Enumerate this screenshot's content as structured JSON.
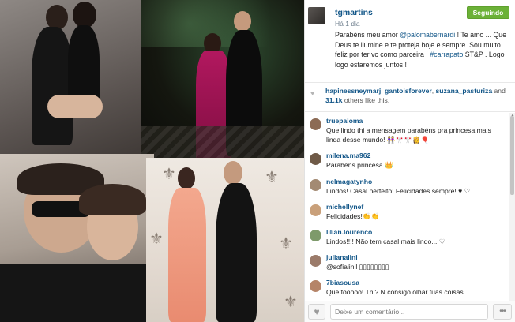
{
  "post": {
    "username": "tgmartins",
    "time": "Há 1 dia",
    "follow_label": "Seguindo",
    "caption_parts": {
      "a": "Parabéns meu amor ",
      "mention": "@palomabernardi",
      "b": " ! Te amo ... Que Deus te ilumine e te proteja hoje e sempre. Sou muito feliz por ter vc como parceira ! ",
      "hashtag": "#carrapato",
      "c": " ST&P . Logo logo estaremos juntos !"
    }
  },
  "likes": {
    "user1": "hapinessneymarj",
    "sep1": ", ",
    "user2": "gantoisforever",
    "sep2": ", ",
    "user3": "suzana_pasturiza",
    "and": " and",
    "count": "31.1k",
    "rest": " others like this."
  },
  "comments": [
    {
      "user": "truepaloma",
      "text": "Que lindo thi a mensagem parabéns pra princesa mais linda desse mundo! 👭🎌🎌👸🎈"
    },
    {
      "user": "milena.ma962",
      "text": "Parabéns princesa 👑"
    },
    {
      "user": "nelmagatynho",
      "text": "Lindos! Casal perfeito! Felicidades sempre! ♥ ♡"
    },
    {
      "user": "michellynef",
      "text": "Felicidades!👏👏"
    },
    {
      "user": "lilian.lourenco",
      "text": "Lindos!!!! Não tem casal mais lindo... ♡"
    },
    {
      "user": "julianalini",
      "text": "@sofialinil ▯▯▯▯▯▯▯▯"
    },
    {
      "user": "7biasousa",
      "text": "Que fooooo! Thi? N consigo olhar tuas coisas"
    }
  ],
  "footer": {
    "comment_placeholder": "Deixe um comentário...",
    "more_label": "•••"
  },
  "colors": {
    "link_blue": "#125688",
    "follow_green": "#6bb137"
  }
}
